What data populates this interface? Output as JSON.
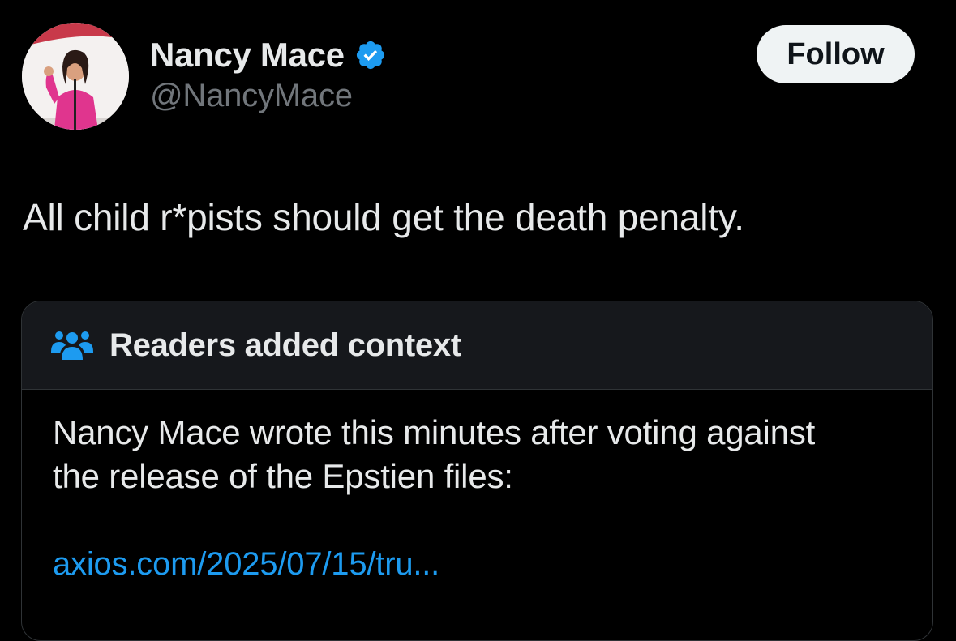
{
  "author": {
    "display_name": "Nancy Mace",
    "handle": "@NancyMace",
    "verified_icon": "verified-badge-icon",
    "avatar_icon": "profile-photo"
  },
  "follow_button": {
    "label": "Follow"
  },
  "tweet": {
    "text": "All child r*pists should get the death penalty."
  },
  "community_note": {
    "icon": "readers-group-icon",
    "title": "Readers added context",
    "body_lines": [
      "Nancy Mace wrote this minutes after voting against",
      "the release of the Epstien files:"
    ],
    "link": "axios.com/2025/07/15/tru..."
  },
  "colors": {
    "background": "#000000",
    "text_primary": "#e7e9ea",
    "text_secondary": "#71767b",
    "accent_blue": "#1d9bf0",
    "note_header_bg": "#16181c",
    "border": "#2f3336",
    "follow_bg": "#eff3f4"
  }
}
